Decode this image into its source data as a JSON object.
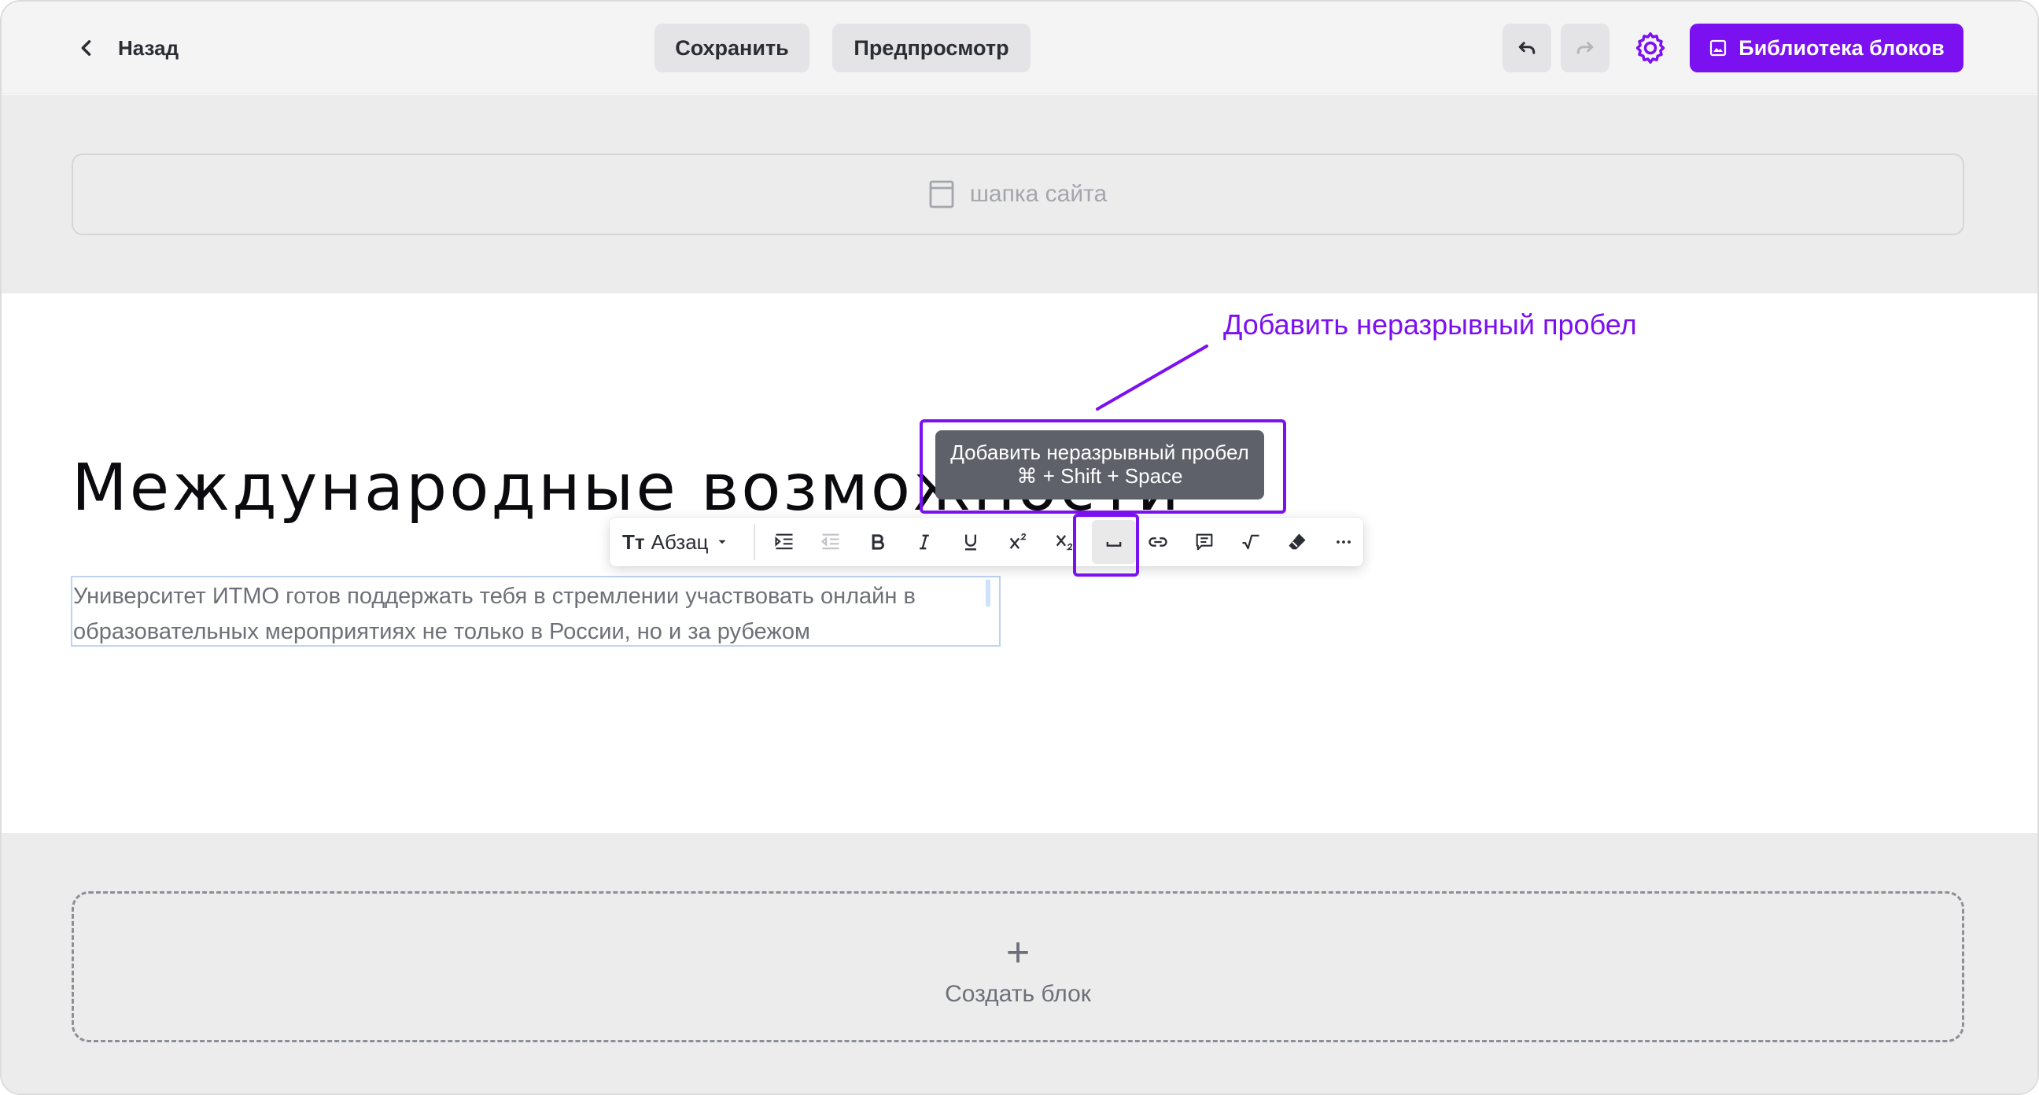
{
  "topbar": {
    "back_label": "Назад",
    "save_label": "Сохранить",
    "preview_label": "Предпросмотр",
    "library_label": "Библиотека блоков",
    "icons": [
      "chevron-left-icon",
      "undo-icon",
      "redo-icon",
      "gear-icon",
      "image-icon"
    ]
  },
  "site_header": {
    "label": "шапка сайта",
    "icon": "page-icon"
  },
  "content": {
    "title": "Международные возможности",
    "paragraph_line1": "Университет ИТМО готов поддержать тебя в стремлении участвовать онлайн в",
    "paragraph_line2": "образовательных мероприятиях не только в России, но и за рубежом"
  },
  "annotation": {
    "label": "Добавить неразрывный пробел"
  },
  "tooltip": {
    "line1": "Добавить неразрывный пробел",
    "line2": "⌘ + Shift + Space"
  },
  "toolbar": {
    "style_icon": "Tт",
    "style_label": "Абзац",
    "buttons": [
      "indent",
      "outdent",
      "bold",
      "italic",
      "underline",
      "superscript",
      "subscript",
      "non-breaking-space",
      "link",
      "comment",
      "formula",
      "eraser",
      "more"
    ]
  },
  "create_block": {
    "plus": "+",
    "label": "Создать блок"
  },
  "colors": {
    "accent": "#7b10f0",
    "tooltip_bg": "#5e6169",
    "panel_bg": "#ececec"
  }
}
